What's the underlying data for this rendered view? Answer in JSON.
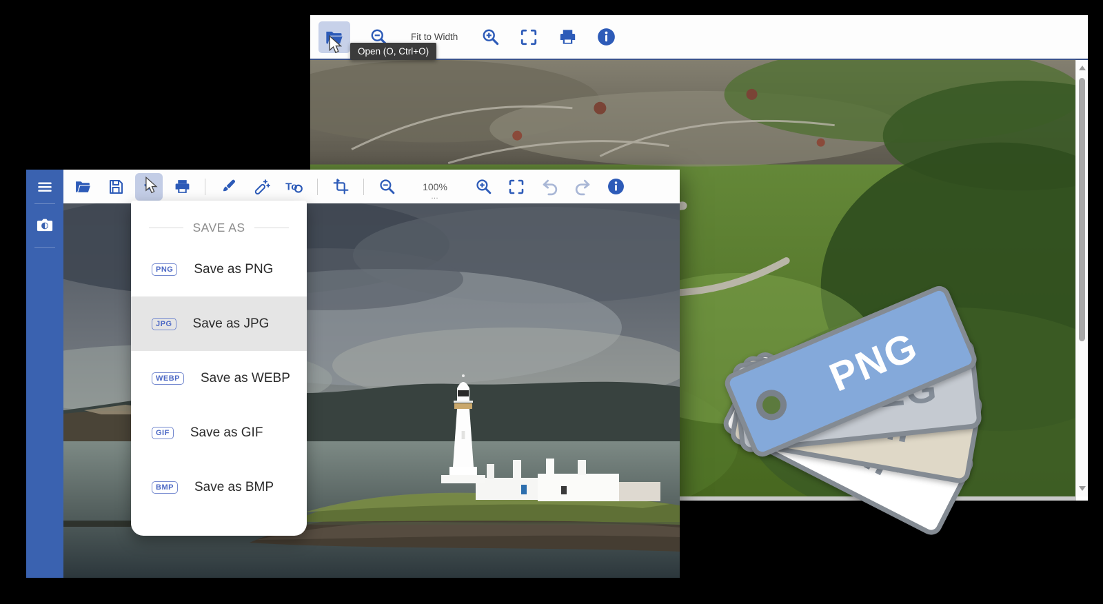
{
  "back_window": {
    "toolbar": {
      "open_button": {
        "tooltip": "Open (O, Ctrl+O)"
      },
      "fit_to_width_label": "Fit to Width",
      "icons": [
        "open-folder-icon",
        "zoom-out-icon",
        "zoom-in-icon",
        "fullscreen-icon",
        "print-icon",
        "info-icon"
      ]
    },
    "scrollbar": {
      "orientation": "vertical"
    },
    "photo": "forest-driftwood-photo"
  },
  "front_window": {
    "sidebar": {
      "icons": [
        "menu-icon",
        "camera-icon"
      ]
    },
    "toolbar": {
      "zoom_level": "100%",
      "zoom_overflow": "…",
      "text_tool_label": "To",
      "icons": [
        "open-folder-icon",
        "save-icon",
        "save-as-icon",
        "print-icon",
        "brush-icon",
        "magic-wand-icon",
        "text-tool-icon",
        "crop-icon",
        "zoom-out-icon",
        "zoom-in-icon",
        "fullscreen-icon",
        "undo-icon",
        "redo-icon",
        "info-icon"
      ]
    },
    "save_menu": {
      "title": "SAVE AS",
      "items": [
        {
          "badge": "PNG",
          "label": "Save as PNG",
          "highlighted": false
        },
        {
          "badge": "JPG",
          "label": "Save as JPG",
          "highlighted": true
        },
        {
          "badge": "WEBP",
          "label": "Save as WEBP",
          "highlighted": false
        },
        {
          "badge": "GIF",
          "label": "Save as GIF",
          "highlighted": false
        },
        {
          "badge": "BMP",
          "label": "Save as BMP",
          "highlighted": false
        }
      ]
    },
    "photo": "lighthouse-island-photo"
  },
  "format_tags": [
    {
      "label": "PNG",
      "color": "#84A9DA",
      "text_color": "#FFFFFF"
    },
    {
      "label": "JPEG",
      "color": "#C5CAD1",
      "text_color": "#848D98"
    },
    {
      "label": "BMP",
      "color": "#DFD8C7",
      "text_color": "#8A939E"
    },
    {
      "label": "GIF",
      "color": "#FFFFFF",
      "text_color": "#8A939E"
    }
  ],
  "colors": {
    "accent_blue": "#2D5BB8",
    "sidebar_blue": "#3A62B0",
    "button_highlight": "#C3CDE6",
    "menu_highlight": "#E5E5E5",
    "tooltip_bg": "#3B3B3B",
    "disabled_icon": "#A9B7D6",
    "tag_border": "#848B93"
  }
}
